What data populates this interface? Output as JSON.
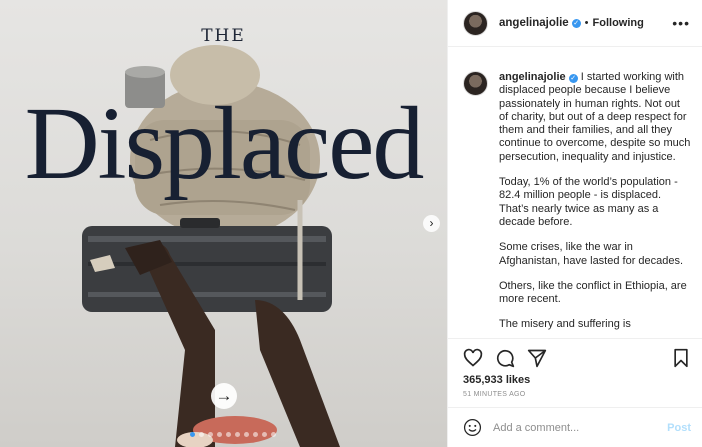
{
  "media": {
    "kicker": "THE",
    "headline": "Displaced"
  },
  "header": {
    "username": "angelinajolie",
    "separator": "•",
    "follow_status": "Following",
    "more_label": "•••"
  },
  "caption": {
    "username": "angelinajolie",
    "paragraphs": [
      "I started working with displaced people because I believe passionately in human rights. Not out of charity, but out of a deep respect for them and their families, and all they continue to overcome, despite so much persecution, inequality and injustice.",
      "Today, 1% of the world’s population - 82.4 million people - is displaced. That’s nearly twice as many as a decade before.",
      "Some crises, like the war in Afghanistan, have lasted for decades.",
      "Others, like the conflict in Ethiopia, are more recent.",
      "The misery and suffering is"
    ]
  },
  "actions": {
    "likes": "365,933 likes",
    "timestamp": "51 MINUTES AGO"
  },
  "comment": {
    "placeholder": "Add a comment...",
    "post_label": "Post"
  },
  "colors": {
    "accent": "#3897f0",
    "post_disabled": "#b2dffc",
    "headline": "#172032"
  }
}
